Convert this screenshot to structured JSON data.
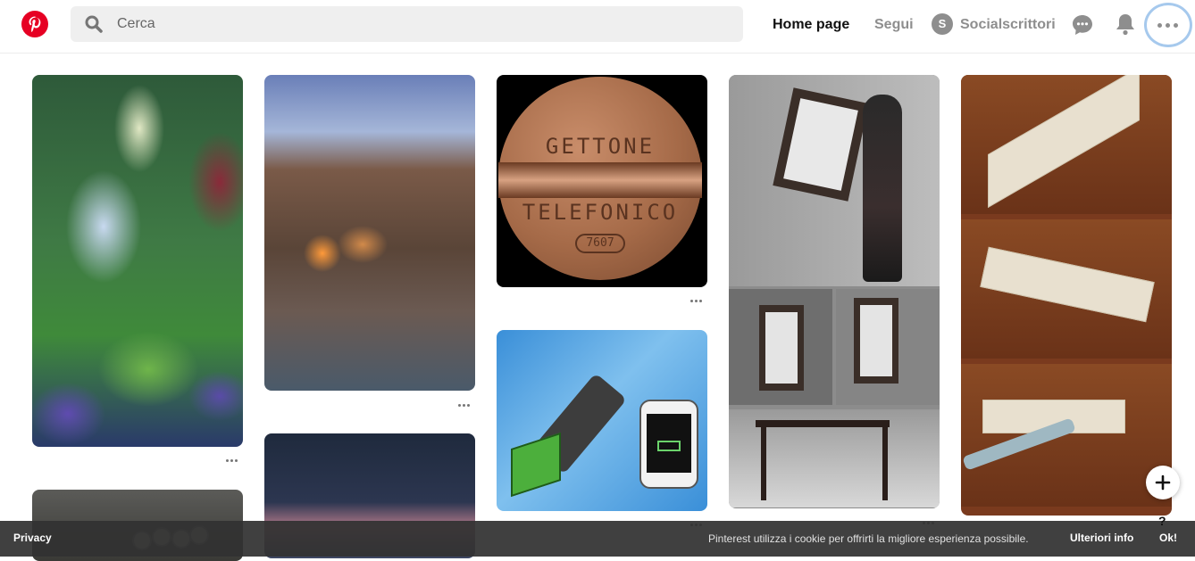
{
  "header": {
    "search_placeholder": "Cerca",
    "nav_home": "Home page",
    "nav_follow": "Segui",
    "profile_initial": "S",
    "profile_name": "Socialscrittori"
  },
  "pins": {
    "coin_top_text": "GETTONE",
    "coin_bottom_text": "TELEFONICO",
    "coin_number": "7607"
  },
  "footer": {
    "privacy": "Privacy",
    "cookie_notice": "Pinterest utilizza i cookie per offrirti la migliore esperienza possibile.",
    "more_info": "Ulteriori info",
    "ok": "Ok!",
    "help": "?"
  },
  "colors": {
    "brand": "#e60023",
    "focus_ring": "#a6c9ed",
    "cookie_bar": "#323232"
  },
  "icons": [
    "pinterest-logo-icon",
    "search-icon",
    "messages-icon",
    "notifications-bell-icon",
    "more-options-icon",
    "add-plus-icon",
    "pin-more-icon"
  ]
}
